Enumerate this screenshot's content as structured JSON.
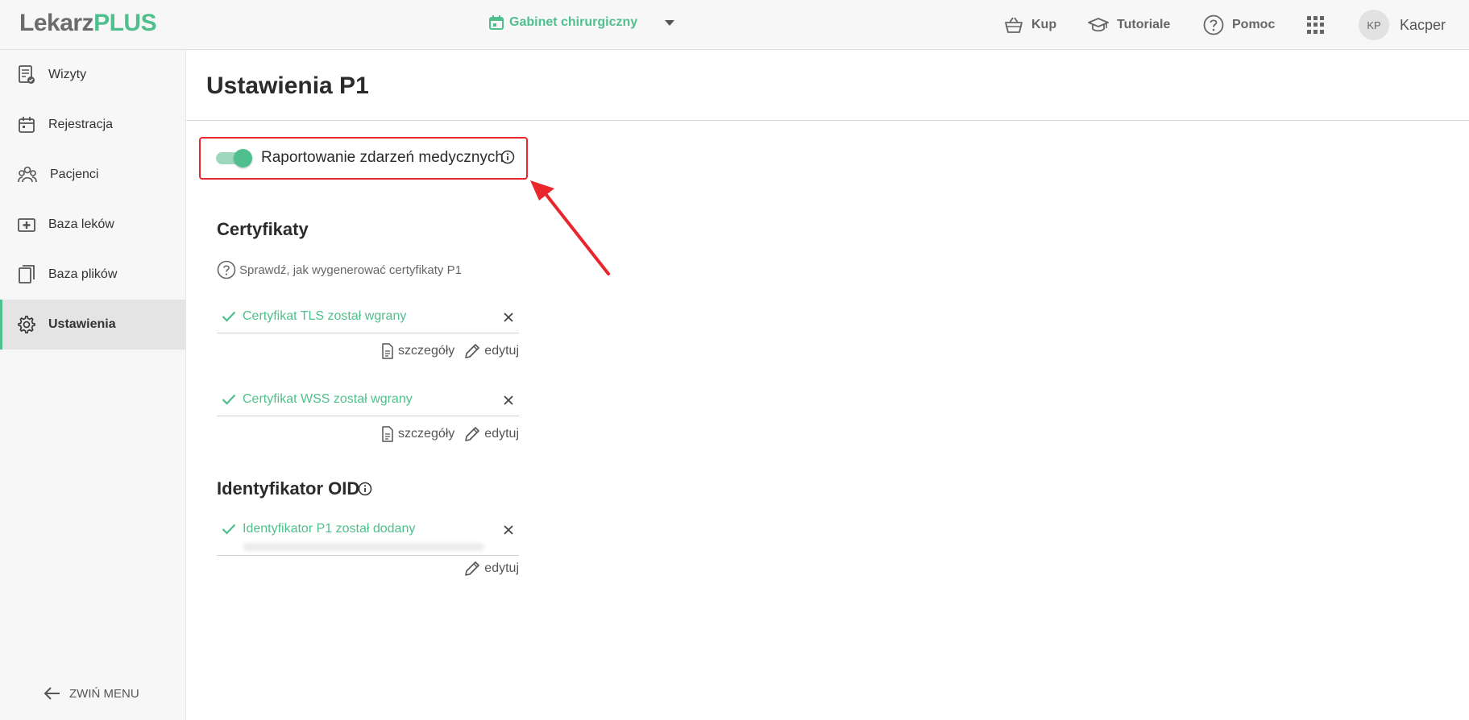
{
  "app": {
    "logo_part1": "Lekarz",
    "logo_part2": "PLUS",
    "brand_color": "#4fc08d"
  },
  "header": {
    "clinic_name": "Gabinet chirurgiczny",
    "nav": {
      "buy": "Kup",
      "tutorials": "Tutoriale",
      "help": "Pomoc"
    },
    "user_initials": "KP",
    "user_name": "Kacper"
  },
  "sidebar": {
    "items": [
      {
        "label": "Wizyty",
        "icon": "visits-icon"
      },
      {
        "label": "Rejestracja",
        "icon": "calendar-icon"
      },
      {
        "label": "Pacjenci",
        "icon": "patients-icon"
      },
      {
        "label": "Baza leków",
        "icon": "medicine-icon"
      },
      {
        "label": "Baza plików",
        "icon": "files-icon"
      },
      {
        "label": "Ustawienia",
        "icon": "gear-icon",
        "active": true
      }
    ],
    "collapse_label": "ZWIŃ MENU"
  },
  "main": {
    "title": "Ustawienia P1",
    "toggle": {
      "label": "Raportowanie zdarzeń medycznych",
      "enabled": true
    },
    "certificates": {
      "heading": "Certyfikaty",
      "help_link": "Sprawdź, jak wygenerować certyfikaty P1",
      "items": [
        {
          "status": "Certyfikat TLS został wgrany",
          "details": "szczegóły",
          "edit": "edytuj"
        },
        {
          "status": "Certyfikat WSS został wgrany",
          "details": "szczegóły",
          "edit": "edytuj"
        }
      ]
    },
    "oid": {
      "heading": "Identyfikator OID",
      "status": "Identyfikator P1 został dodany",
      "edit": "edytuj"
    }
  }
}
